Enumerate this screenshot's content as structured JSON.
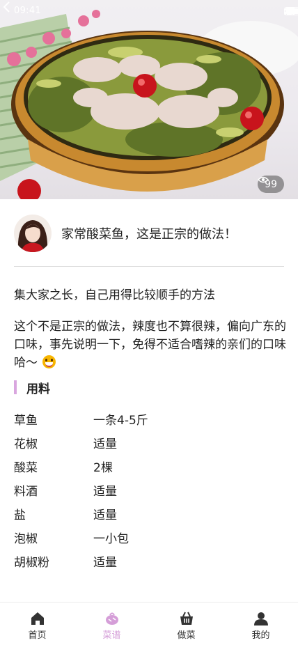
{
  "status_bar": {
    "time": "09:41"
  },
  "hero": {
    "views": "99"
  },
  "recipe": {
    "title": "家常酸菜鱼，这是正宗的做法！",
    "intro": "集大家之长，自己用得比较顺手的方法",
    "note": "这个不是正宗的做法，辣度也不算很辣，偏向广东的口味，事先说明一下，免得不适合嗜辣的亲们的口味哈～"
  },
  "ingredients_section": {
    "title": "用料",
    "items": [
      {
        "name": "草鱼",
        "amount": "一条4-5斤"
      },
      {
        "name": "花椒",
        "amount": "适量"
      },
      {
        "name": "酸菜",
        "amount": "2棵"
      },
      {
        "name": "料酒",
        "amount": "适量"
      },
      {
        "name": "盐",
        "amount": "适量"
      },
      {
        "name": "泡椒",
        "amount": "一小包"
      },
      {
        "name": "胡椒粉",
        "amount": "适量"
      }
    ]
  },
  "tabbar": {
    "tabs": [
      {
        "label": "首页",
        "icon": "home-icon"
      },
      {
        "label": "菜谱",
        "icon": "recipe-icon",
        "active": true
      },
      {
        "label": "做菜",
        "icon": "basket-icon"
      },
      {
        "label": "我的",
        "icon": "user-icon"
      }
    ],
    "active_color": "#d59ed8"
  },
  "colors": {
    "accent": "#d9a6df"
  }
}
